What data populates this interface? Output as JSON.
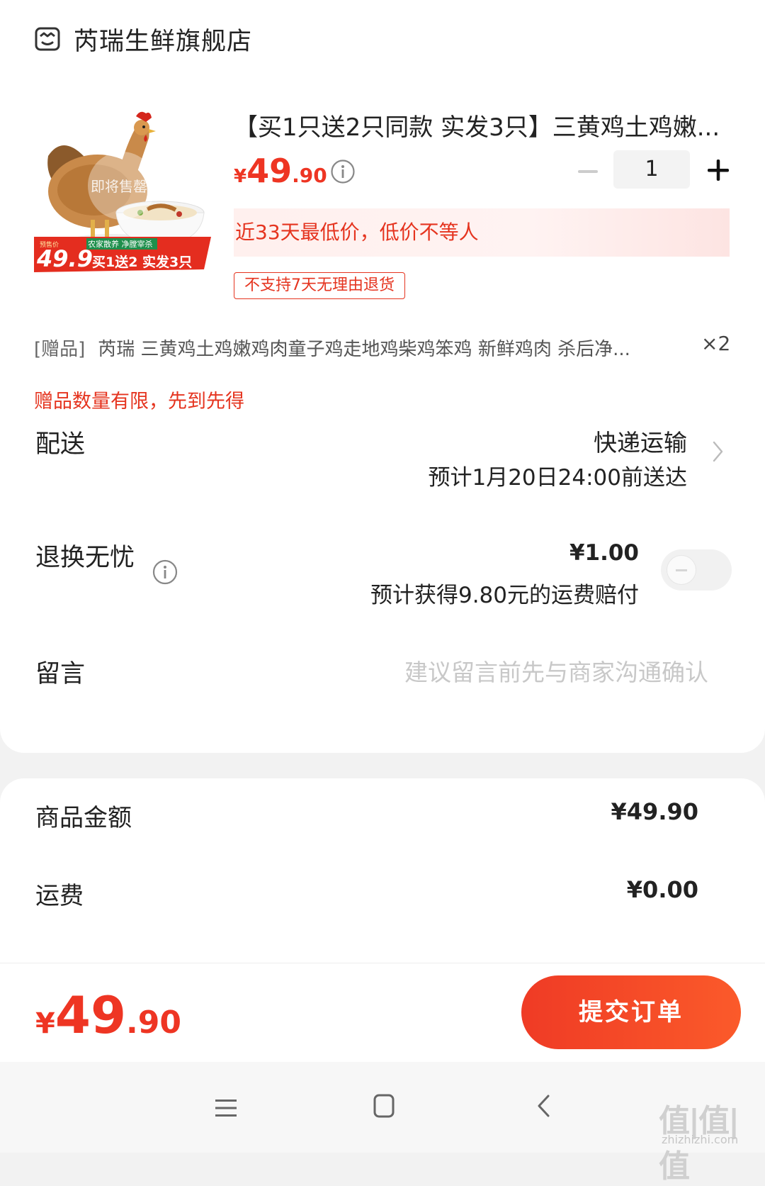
{
  "store": {
    "name": "芮瑞生鲜旗舰店",
    "icon": "store-icon"
  },
  "product": {
    "title": "【买1只送2只同款 实发3只】三黄鸡土鸡嫩...",
    "price_currency": "¥",
    "price_int": "49",
    "price_dec": ".90",
    "quantity": "1",
    "lowest_price_note": "近33天最低价，低价不等人",
    "return_policy_tag": "不支持7天无理由退货",
    "image": {
      "watermark_text": "即将售罄",
      "badge_price_label": "预售价",
      "badge_price": "49.9",
      "badge_slogan": "农家散养 净膛宰杀",
      "badge_promo": "买1送2 实发3只"
    }
  },
  "gift": {
    "tag": "[赠品]",
    "title": "芮瑞 三黄鸡土鸡嫩鸡肉童子鸡走地鸡柴鸡笨鸡 新鲜鸡肉 杀后净...",
    "qty": "×2",
    "notice": "赠品数量有限，先到先得"
  },
  "delivery": {
    "label": "配送",
    "method": "快递运输",
    "eta": "预计1月20日24:00前送达"
  },
  "return_insurance": {
    "label": "退换无忧",
    "price": "¥1.00",
    "note": "预计获得9.80元的运费赔付",
    "enabled": false
  },
  "message": {
    "label": "留言",
    "placeholder": "建议留言前先与商家沟通确认"
  },
  "summary": {
    "goods_label": "商品金额",
    "goods_value": "¥49.90",
    "shipping_label": "运费",
    "shipping_value": "¥0.00"
  },
  "checkout": {
    "total_currency": "¥",
    "total_int": "49",
    "total_dec": ".90",
    "submit_label": "提交订单"
  },
  "watermark": {
    "text": "值|值|值",
    "sub": "zhizhizhi.com"
  },
  "colors": {
    "accent": "#ee3523",
    "button_start": "#ef3b25",
    "button_end": "#fb5a2a"
  }
}
